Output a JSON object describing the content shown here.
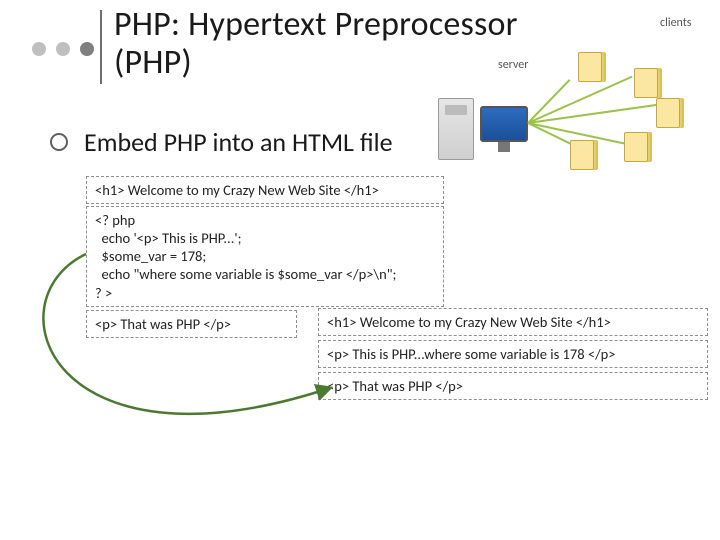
{
  "title_line1": "PHP: Hypertext Preprocessor",
  "title_line2": "(PHP)",
  "bullet": "Embed PHP into an HTML file",
  "diagram": {
    "server_label": "server",
    "clients_label": "clients"
  },
  "code": {
    "box1": "<h1> Welcome to my Crazy New Web Site </h1>",
    "box2": "<? php\n  echo '<p> This is PHP...';\n  $some_var = 178;\n  echo \"where some variable is $some_var </p>\\n\";\n? >",
    "box3": "<p> That was PHP </p>",
    "box4": "<h1> Welcome to my Crazy New Web Site </h1>",
    "box5": "<p> This is PHP...where some variable is 178 </p>",
    "box6": "<p> That was PHP </p>"
  }
}
